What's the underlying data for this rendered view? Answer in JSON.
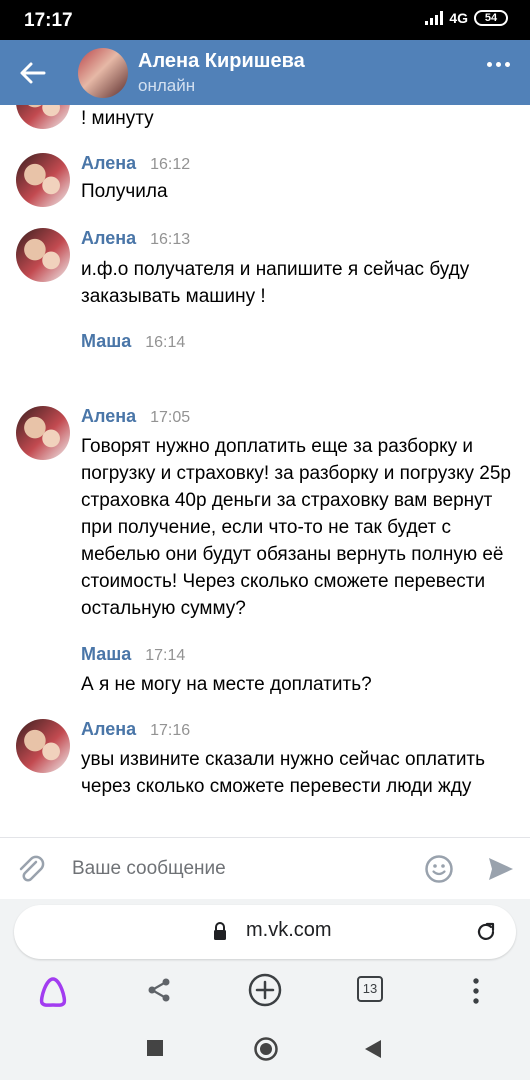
{
  "status_bar": {
    "time": "17:17",
    "network": "4G",
    "battery": "54"
  },
  "header": {
    "name": "Алена Киришева",
    "status": "онлайн"
  },
  "messages": [
    {
      "author": "",
      "time": "",
      "text": "! минуту"
    },
    {
      "author": "Алена",
      "time": "16:12",
      "text": "Получила"
    },
    {
      "author": "Алена",
      "time": "16:13",
      "text": "и.ф.о получателя и напишите я сейчас буду заказывать машину !"
    },
    {
      "author": "Маша",
      "time": "16:14",
      "text": ""
    },
    {
      "author": "Алена",
      "time": "17:05",
      "text": "Говорят нужно доплатить еще за разборку и погрузку и страховку! за разборку и погрузку 25р страховка 40р деньги за страховку вам вернут при получение, если что-то не так будет с мебелью они будут обязаны вернуть полную её стоимость! Через сколько сможете перевести остальную сумму?"
    },
    {
      "author": "Маша",
      "time": "17:14",
      "text": "А я не могу на месте доплатить?"
    },
    {
      "author": "Алена",
      "time": "17:16",
      "text": "увы извините сказали нужно сейчас оплатить через сколько сможете перевести люди жду"
    }
  ],
  "compose": {
    "placeholder": "Ваше сообщение"
  },
  "browser": {
    "url": "m.vk.com",
    "tabs_count": "13"
  },
  "icons": {
    "back": "arrow-left-icon",
    "more": "more-horizontal-icon",
    "attach": "paperclip-icon",
    "emoji": "smile-icon",
    "send": "send-icon",
    "lock": "lock-icon",
    "reload": "reload-icon",
    "assistant": "alice-icon",
    "share": "share-icon",
    "new_tab": "plus-circle-icon",
    "tabs": "tabs-icon",
    "menu": "more-vertical-icon",
    "stop": "square-icon",
    "home": "circle-icon",
    "nav_back": "triangle-back-icon"
  },
  "colors": {
    "header": "#5181b8",
    "author": "#4a76a8",
    "assistant": "#a23cf0"
  }
}
